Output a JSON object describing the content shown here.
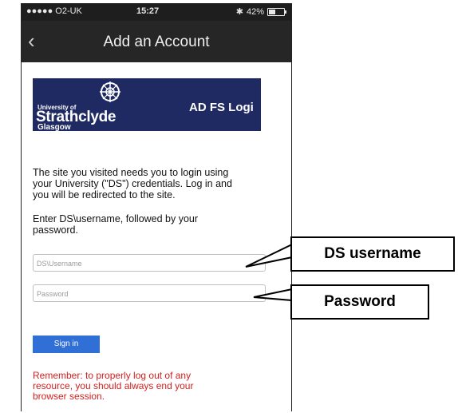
{
  "status_bar": {
    "carrier": "●●●●● O2-UK",
    "time": "15:27",
    "battery": "42%",
    "battery_level": 0.42
  },
  "nav": {
    "back_icon": "chevron-left-icon",
    "title": "Add an Account"
  },
  "banner": {
    "university_small": "University of",
    "university_big": "Strathclyde",
    "university_city": "Glasgow",
    "login_title": "AD FS Logi",
    "background_color": "#1f2a62"
  },
  "intro": {
    "line1": "The site you visited needs you to login using",
    "line2": "your University (\"DS\") credentials. Log in and",
    "line3": "you will be redirected to the site."
  },
  "instruction": {
    "line1": "Enter DS\\username, followed by your",
    "line2": "password."
  },
  "form": {
    "username_placeholder": "DS\\Username",
    "password_placeholder": "Password",
    "signin_label": "Sign in",
    "signin_color": "#2f6fd6"
  },
  "warning": {
    "line1": "Remember: to properly log out of any",
    "line2": "resource, you should always end your",
    "line3": "browser session.",
    "color": "#d21f1f"
  },
  "callouts": {
    "username": "DS username",
    "password": "Password"
  }
}
